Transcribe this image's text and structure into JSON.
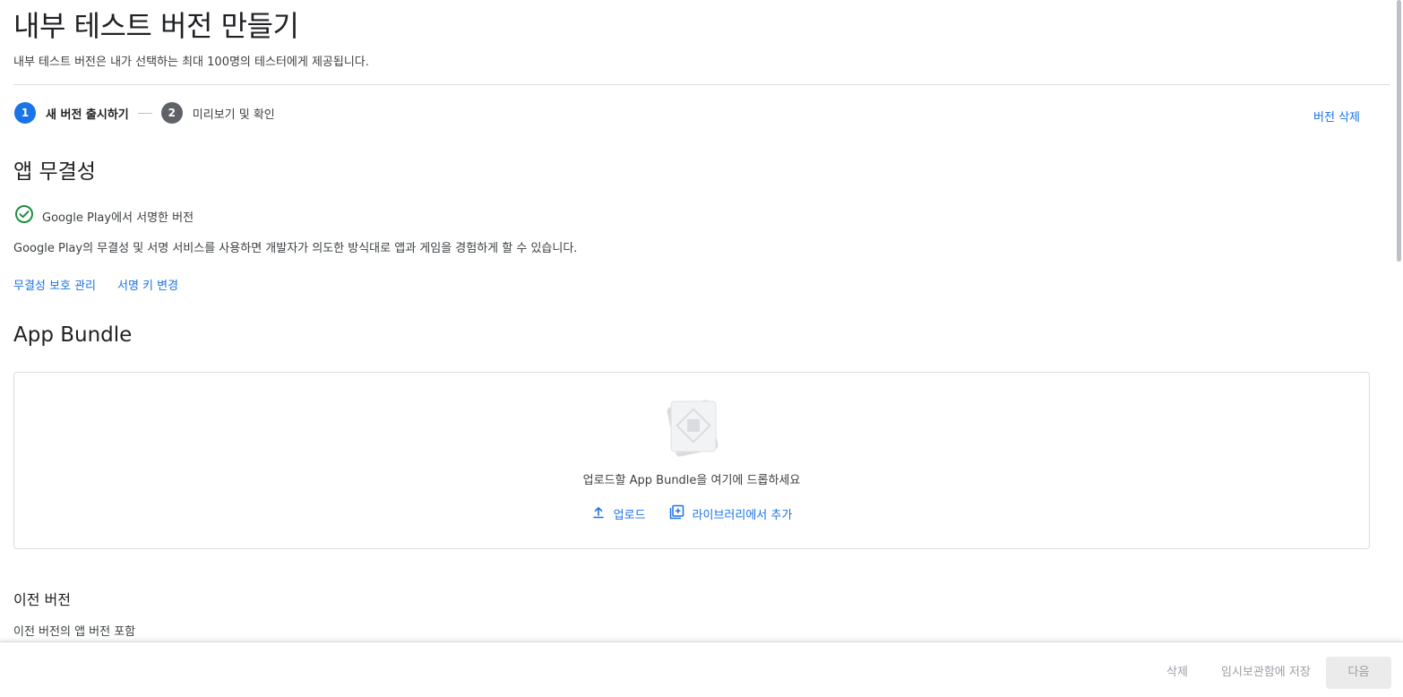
{
  "header": {
    "title": "내부 테스트 버전 만들기",
    "subtitle": "내부 테스트 버전은 내가 선택하는 최대 100명의 테스터에게 제공됩니다."
  },
  "stepper": {
    "steps": [
      {
        "number": "1",
        "label": "새 버전 출시하기",
        "state": "active"
      },
      {
        "number": "2",
        "label": "미리보기 및 확인",
        "state": "inactive"
      }
    ],
    "delete_version_label": "버전 삭제"
  },
  "integrity": {
    "heading": "앱 무결성",
    "signed_label": "Google Play에서 서명한 버전",
    "signed_icon": "check-circle-icon",
    "description": "Google Play의 무결성 및 서명 서비스를 사용하면 개발자가 의도한 방식대로 앱과 게임을 경험하게 할 수 있습니다.",
    "links": {
      "manage_protection": "무결성 보호 관리",
      "change_signing_key": "서명 키 변경"
    }
  },
  "app_bundle": {
    "heading": "App Bundle",
    "drop_text": "업로드할 App Bundle을 여기에 드롭하세요",
    "upload_label": "업로드",
    "add_from_library_label": "라이브러리에서 추가"
  },
  "previous_versions": {
    "heading": "이전 버전",
    "description": "이전 버전의 앱 버전 포함"
  },
  "footer": {
    "delete_label": "삭제",
    "save_draft_label": "임시보관함에 저장",
    "next_label": "다음"
  },
  "colors": {
    "primary": "#1a73e8",
    "success": "#1e8e3e",
    "text": "#202124",
    "secondary_text": "#3c4043",
    "disabled_text": "#9aa0a6",
    "divider": "#dadce0"
  }
}
